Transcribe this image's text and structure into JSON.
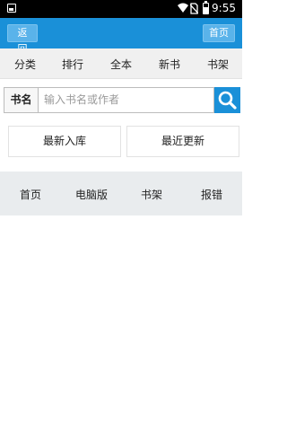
{
  "status_bar": {
    "time": "9:55",
    "icons": [
      "image-notification-icon",
      "wifi-icon",
      "no-sim-icon",
      "battery-icon"
    ]
  },
  "app_bar": {
    "back_label": "返回",
    "home_label": "首页",
    "background_color": "#1a90d8"
  },
  "nav": {
    "items": [
      "分类",
      "排行",
      "全本",
      "新书",
      "书架"
    ]
  },
  "search": {
    "label": "书名",
    "placeholder": "输入书名或作者",
    "button_icon": "search-icon"
  },
  "quick_links": {
    "latest_in": "最新入库",
    "recent_update": "最近更新"
  },
  "footer_nav": {
    "items": [
      "首页",
      "电脑版",
      "书架",
      "报错"
    ]
  }
}
